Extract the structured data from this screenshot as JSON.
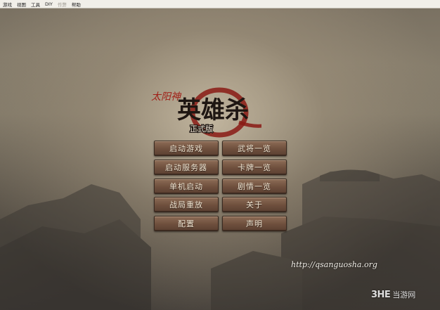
{
  "menu": {
    "items": [
      {
        "label": "游戏"
      },
      {
        "label": "视图"
      },
      {
        "label": "工具"
      },
      {
        "label": "DIY"
      },
      {
        "label": "作弊"
      },
      {
        "label": "帮助"
      }
    ]
  },
  "logo": {
    "subtitle": "太阳神",
    "title": "英雄杀",
    "badge": "正式版"
  },
  "buttons": {
    "start_game": "启动游戏",
    "start_server": "启动服务器",
    "single_player": "单机启动",
    "replay": "战局重放",
    "config": "配置",
    "generals": "武将一览",
    "cards": "卡牌一览",
    "scenarios": "剧情一览",
    "about": "关于",
    "notice": "声明"
  },
  "footer": {
    "url": "http://qsanguosha.org",
    "watermark_brand": "3HE",
    "watermark_site": "当游网"
  },
  "colors": {
    "button_face": "#6e4f3d",
    "button_text": "#f2e6d2",
    "logo_red": "#9b1d16"
  }
}
